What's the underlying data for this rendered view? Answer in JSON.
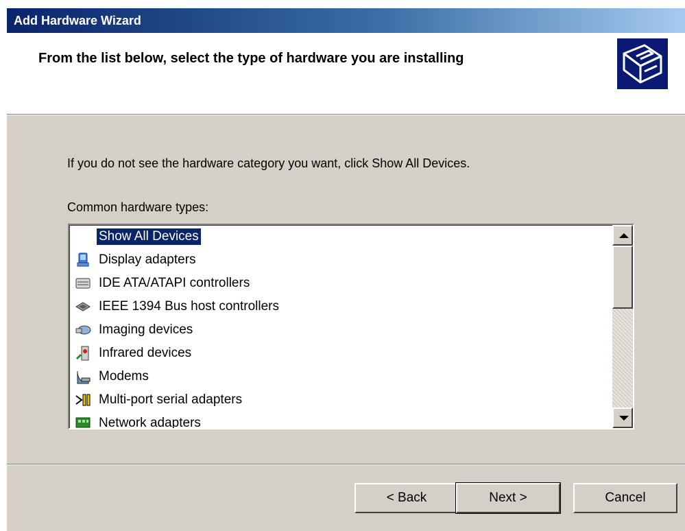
{
  "window": {
    "title": "Add Hardware Wizard"
  },
  "header": {
    "heading": "From the list below, select the type of hardware you are installing",
    "icon": "hardware-wizard-icon"
  },
  "body": {
    "intro": "If you do not see the hardware category you want, click Show All Devices.",
    "list_label": "Common hardware types:"
  },
  "list": {
    "selected_index": 0,
    "items": [
      {
        "label": "Show All Devices",
        "icon": "none"
      },
      {
        "label": "Display adapters",
        "icon": "display-adapter-icon"
      },
      {
        "label": "IDE ATA/ATAPI controllers",
        "icon": "ide-controller-icon"
      },
      {
        "label": "IEEE 1394 Bus host controllers",
        "icon": "ieee1394-controller-icon"
      },
      {
        "label": "Imaging devices",
        "icon": "imaging-device-icon"
      },
      {
        "label": "Infrared devices",
        "icon": "infrared-device-icon"
      },
      {
        "label": "Modems",
        "icon": "modem-icon"
      },
      {
        "label": "Multi-port serial adapters",
        "icon": "serial-adapter-icon"
      },
      {
        "label": "Network adapters",
        "icon": "network-adapter-icon"
      }
    ]
  },
  "buttons": {
    "back": "< Back",
    "next": "Next >",
    "cancel": "Cancel"
  }
}
